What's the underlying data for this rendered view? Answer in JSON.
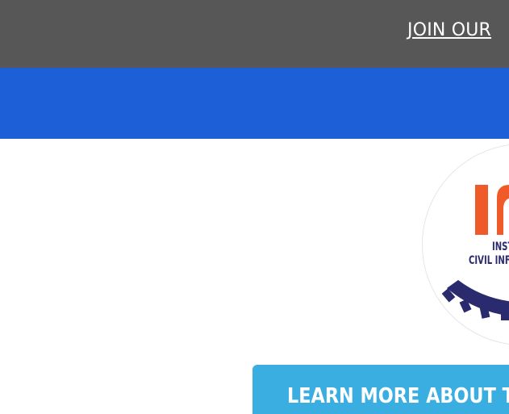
{
  "header": {
    "join_link": "JOIN OUR"
  },
  "logo": {
    "line1": "INST",
    "line2": "CIVIL INF",
    "colors": {
      "orange": "#f05a28",
      "navy": "#2a2a6e"
    }
  },
  "cta": {
    "label": "LEARN MORE ABOUT T"
  },
  "colors": {
    "top_bar": "#575757",
    "blue_band": "#1c5fd6",
    "cta_button": "#3aaee0"
  }
}
